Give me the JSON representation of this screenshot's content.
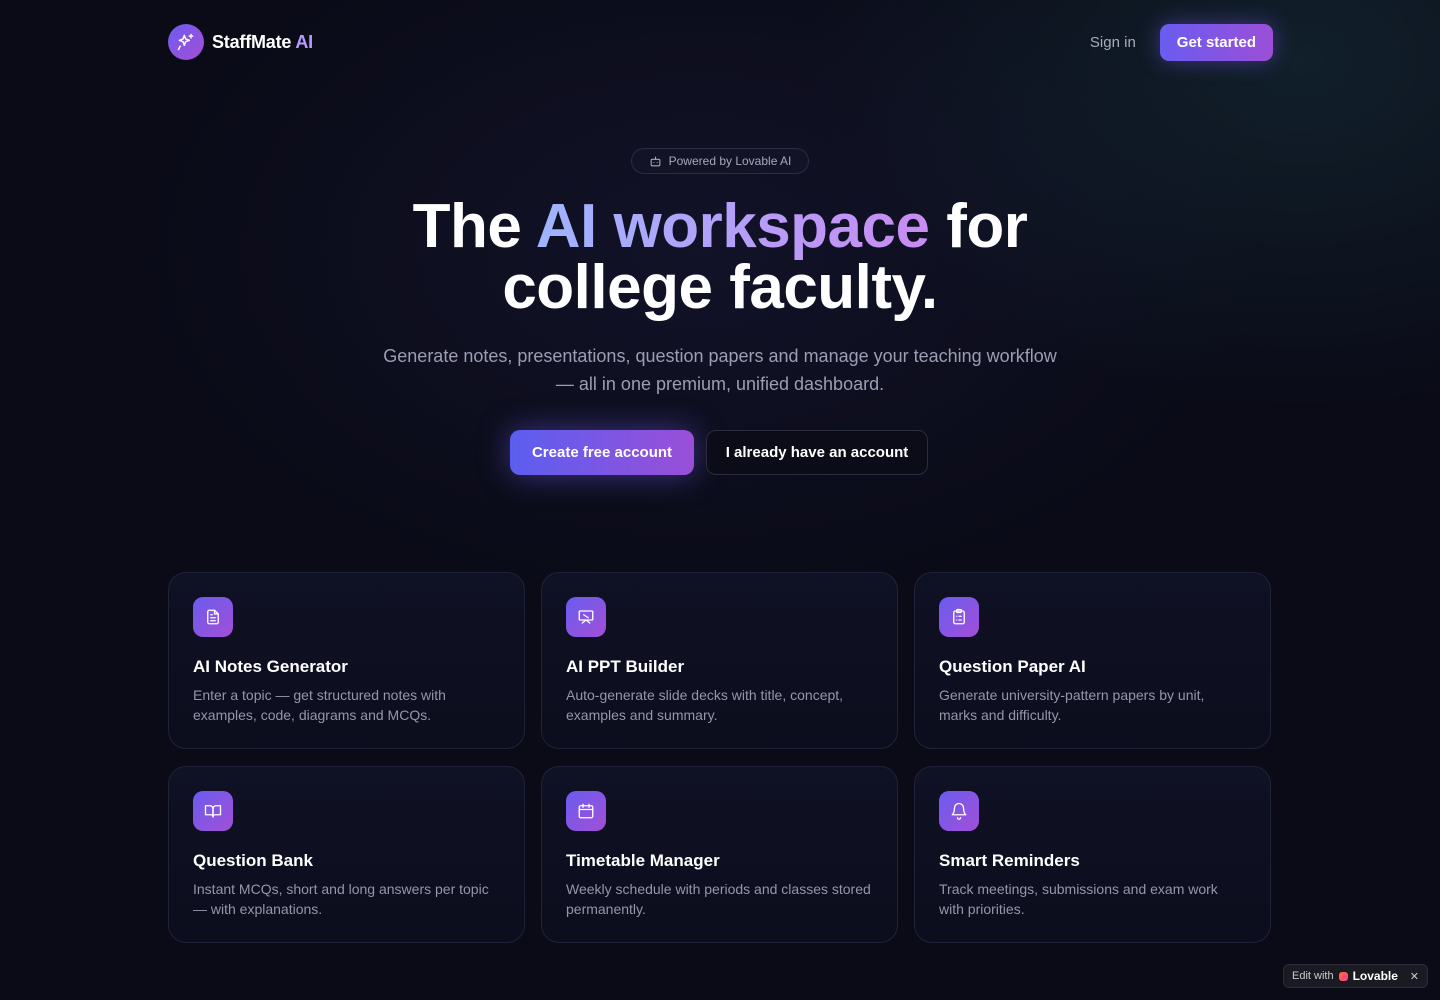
{
  "nav": {
    "brand_name": "StaffMate",
    "brand_suffix": "AI",
    "sign_in": "Sign in",
    "get_started": "Get started"
  },
  "hero": {
    "badge": "Powered by Lovable AI",
    "headline_part1": "The",
    "headline_highlight": "AI workspace",
    "headline_part2": "for",
    "headline_line2": "college faculty.",
    "subtitle": "Generate notes, presentations, question papers and manage your teaching workflow — all in one premium, unified dashboard.",
    "cta_primary": "Create free account",
    "cta_secondary": "I already have an account"
  },
  "features": [
    {
      "icon": "document-icon",
      "title": "AI Notes Generator",
      "desc": "Enter a topic — get structured notes with examples, code, diagrams and MCQs."
    },
    {
      "icon": "presentation-icon",
      "title": "AI PPT Builder",
      "desc": "Auto-generate slide decks with title, concept, examples and summary."
    },
    {
      "icon": "clipboard-icon",
      "title": "Question Paper AI",
      "desc": "Generate university-pattern papers by unit, marks and difficulty."
    },
    {
      "icon": "book-icon",
      "title": "Question Bank",
      "desc": "Instant MCQs, short and long answers per topic — with explanations."
    },
    {
      "icon": "calendar-icon",
      "title": "Timetable Manager",
      "desc": "Weekly schedule with periods and classes stored permanently."
    },
    {
      "icon": "bell-icon",
      "title": "Smart Reminders",
      "desc": "Track meetings, submissions and exam work with priorities."
    }
  ],
  "lovable_badge": {
    "prefix": "Edit with",
    "brand": "Lovable",
    "close": "✕"
  },
  "colors": {
    "background": "#0a0b17",
    "accent_start": "#6a5cf0",
    "accent_end": "#a24fd6"
  }
}
